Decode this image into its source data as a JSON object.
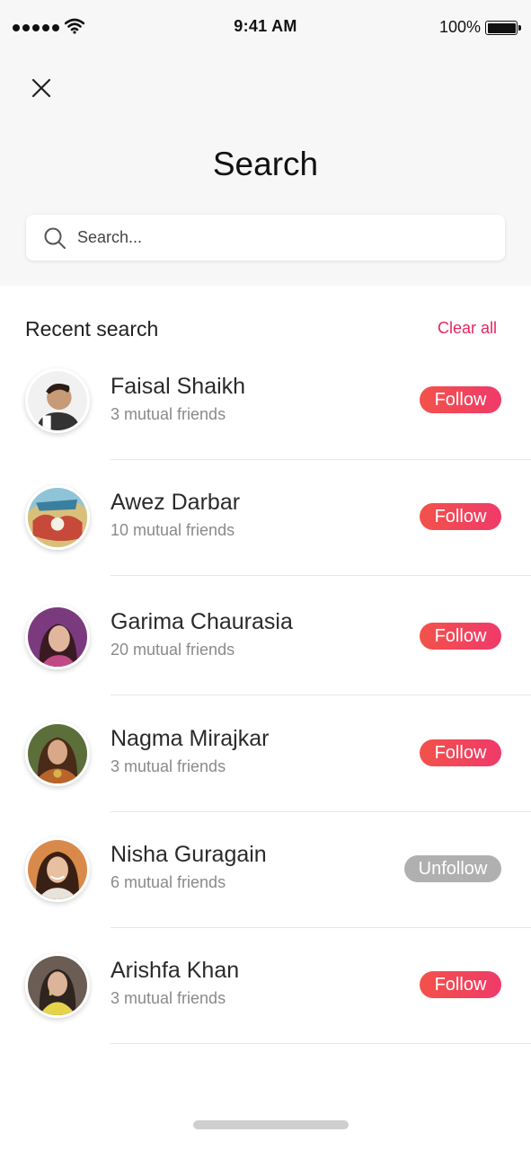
{
  "status_bar": {
    "time": "9:41 AM",
    "battery_percent": "100%",
    "signal_icon": "cellular-signal-icon",
    "wifi_icon": "wifi-icon",
    "battery_icon": "battery-icon"
  },
  "header": {
    "close_icon": "close-icon",
    "title": "Search"
  },
  "search": {
    "placeholder": "Search...",
    "value": "",
    "icon": "search-icon"
  },
  "recent": {
    "title": "Recent search",
    "clear_label": "Clear all",
    "users": [
      {
        "name": "Faisal Shaikh",
        "mutual": "3 mutual friends",
        "action": "Follow",
        "state": "follow"
      },
      {
        "name": "Awez Darbar",
        "mutual": "10 mutual friends",
        "action": "Follow",
        "state": "follow"
      },
      {
        "name": "Garima Chaurasia",
        "mutual": "20 mutual friends",
        "action": "Follow",
        "state": "follow"
      },
      {
        "name": "Nagma Mirajkar",
        "mutual": "3 mutual friends",
        "action": "Follow",
        "state": "follow"
      },
      {
        "name": "Nisha Guragain",
        "mutual": "6 mutual friends",
        "action": "Unfollow",
        "state": "unfollow"
      },
      {
        "name": "Arishfa Khan",
        "mutual": "3 mutual friends",
        "action": "Follow",
        "state": "follow"
      }
    ]
  },
  "colors": {
    "accent": "#e5285f",
    "follow_start": "#f2524a",
    "follow_end": "#f03a6a",
    "unfollow": "#b0b0b0",
    "header_bg": "#f7f7f7"
  }
}
